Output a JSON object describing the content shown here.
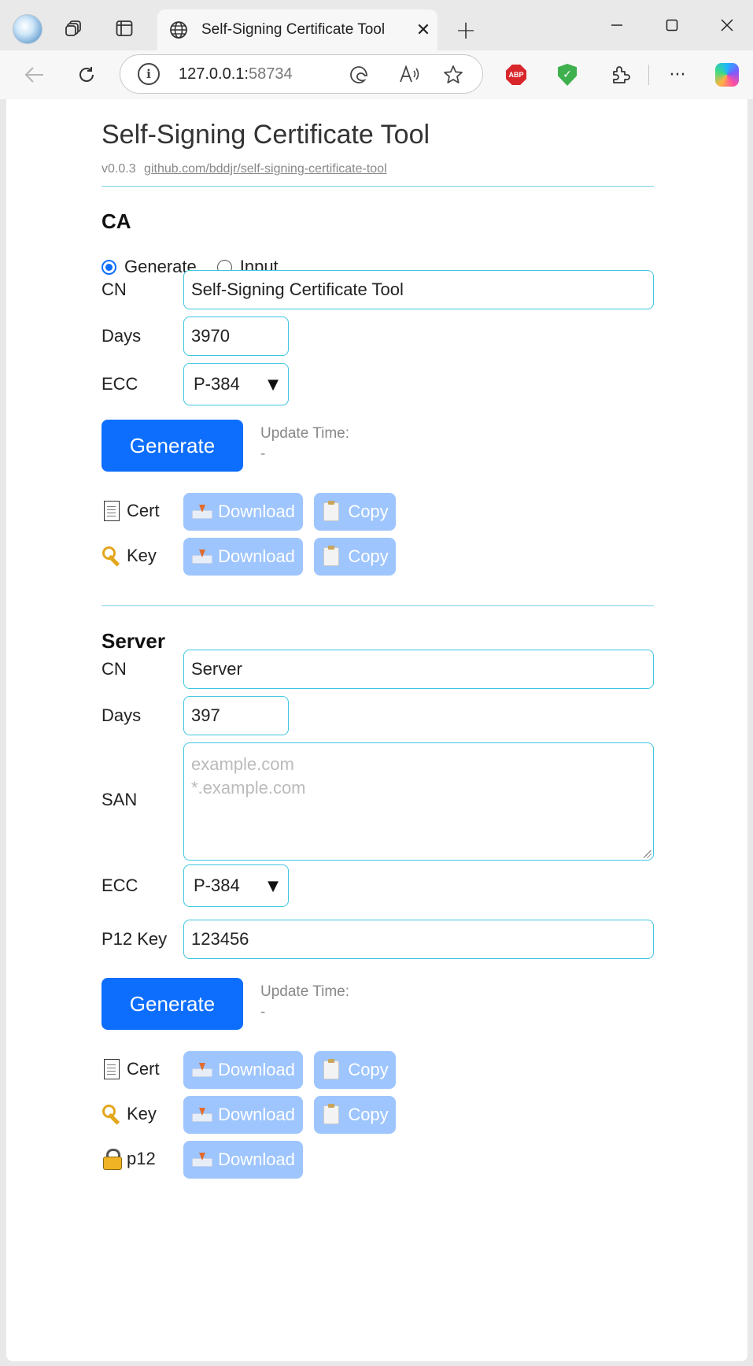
{
  "browser": {
    "tab_title": "Self-Signing Certificate Tool",
    "url_host": "127.0.0.1:",
    "url_port": "58734",
    "abp_label": "ABP",
    "icons": [
      "profile-avatar",
      "workspaces-icon",
      "tab-actions-icon",
      "globe-icon",
      "close-icon",
      "new-tab-icon",
      "minimize-icon",
      "maximize-icon",
      "close-window-icon",
      "back-icon",
      "refresh-icon",
      "info-icon",
      "edge-icon",
      "read-aloud-icon",
      "favorite-icon",
      "adblock-icon",
      "shield-icon",
      "extensions-icon",
      "more-icon",
      "copilot-icon"
    ]
  },
  "app": {
    "title": "Self-Signing Certificate Tool",
    "version": "v0.0.3",
    "repo_link": "github.com/bddjr/self-signing-certificate-tool"
  },
  "ca": {
    "heading": "CA",
    "mode_options": [
      "Generate",
      "Input"
    ],
    "mode_selected": "Generate",
    "cn_label": "CN",
    "cn_value": "Self-Signing Certificate Tool",
    "days_label": "Days",
    "days_value": "3970",
    "ecc_label": "ECC",
    "ecc_value": "P-384",
    "generate_label": "Generate",
    "update_time_label": "Update Time:",
    "update_time_value": "-",
    "cert_label": "Cert",
    "key_label": "Key",
    "download_label": "Download",
    "copy_label": "Copy"
  },
  "server": {
    "heading": "Server",
    "cn_label": "CN",
    "cn_value": "Server",
    "days_label": "Days",
    "days_value": "397",
    "san_label": "SAN",
    "san_placeholder_line1": "example.com",
    "san_placeholder_line2": "*.example.com",
    "ecc_label": "ECC",
    "ecc_value": "P-384",
    "p12_key_label": "P12 Key",
    "p12_key_value": "123456",
    "generate_label": "Generate",
    "update_time_label": "Update Time:",
    "update_time_value": "-",
    "cert_label": "Cert",
    "key_label": "Key",
    "p12_label": "p12",
    "download_label": "Download",
    "copy_label": "Copy"
  },
  "colors": {
    "primary": "#0d6efd",
    "primary_disabled": "#9ec5fe",
    "input_border": "#3ec6e0",
    "divider": "#7ed3e6"
  }
}
